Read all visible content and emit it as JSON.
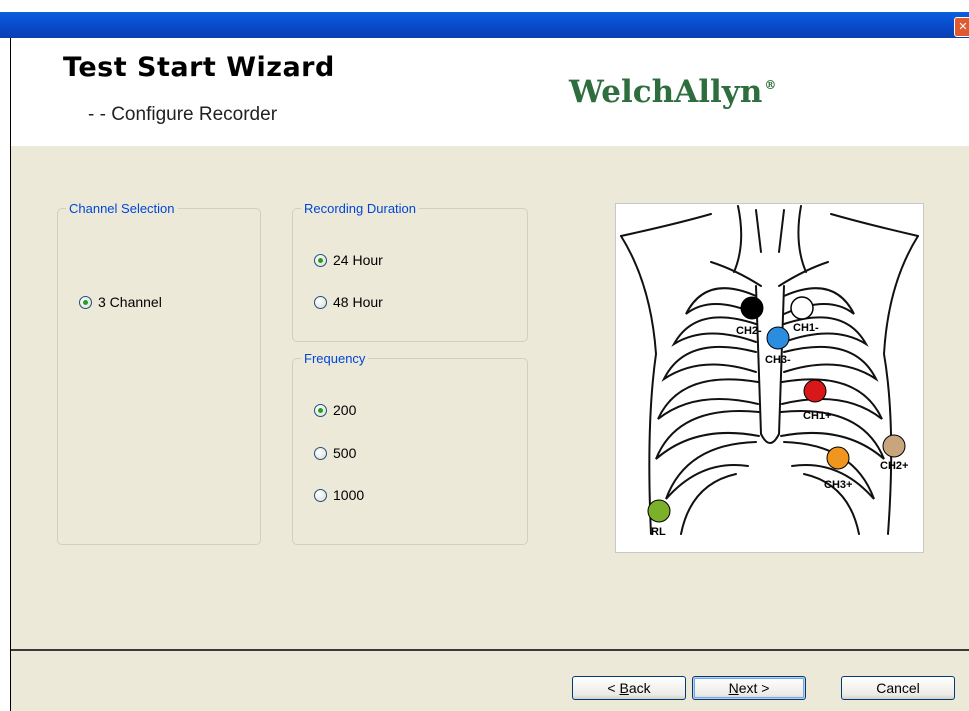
{
  "window": {
    "close_glyph": "✕"
  },
  "header": {
    "title": "Test Start Wizard",
    "subtitle": "- - Configure Recorder",
    "logo_text": "WelchAllyn",
    "logo_mark": "®",
    "logo_color": "#2e6e3e"
  },
  "channel_selection": {
    "legend": "Channel Selection",
    "options": [
      {
        "label": "3 Channel",
        "selected": true
      }
    ]
  },
  "recording_duration": {
    "legend": "Recording Duration",
    "options": [
      {
        "label": "24 Hour",
        "selected": true
      },
      {
        "label": "48 Hour",
        "selected": false
      }
    ]
  },
  "frequency": {
    "legend": "Frequency",
    "options": [
      {
        "label": "200",
        "selected": true
      },
      {
        "label": "500",
        "selected": false
      },
      {
        "label": "1000",
        "selected": false
      }
    ]
  },
  "electrode_diagram": {
    "electrodes": [
      {
        "label": "CH2-",
        "color": "#000000"
      },
      {
        "label": "CH1-",
        "color": "#ffffff"
      },
      {
        "label": "CH3-",
        "color": "#2b8de0"
      },
      {
        "label": "CH1+",
        "color": "#d81818"
      },
      {
        "label": "CH2+",
        "color": "#c9a57e"
      },
      {
        "label": "CH3+",
        "color": "#f0961e"
      },
      {
        "label": "RL",
        "color": "#7ab02a"
      }
    ]
  },
  "buttons": {
    "back": {
      "pre": "< ",
      "access": "B",
      "post": "ack"
    },
    "next": {
      "access": "N",
      "post": "ext >"
    },
    "cancel": "Cancel"
  },
  "colors": {
    "accent": "#0046d5",
    "panel_bg": "#ece9d8",
    "titlebar": "#0a5fe0"
  }
}
